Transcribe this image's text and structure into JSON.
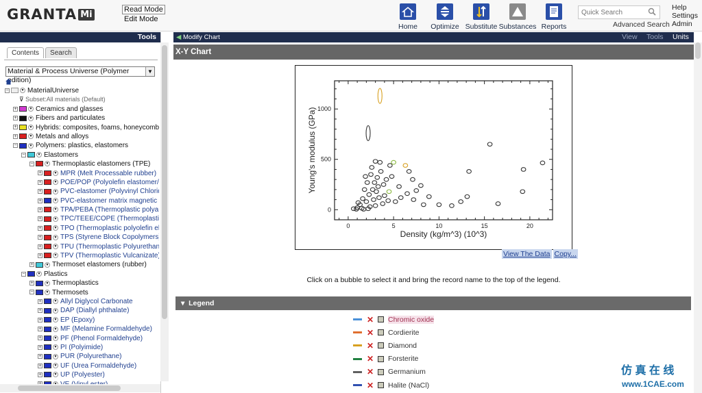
{
  "header": {
    "logo_text": "GRANTA",
    "logo_mi": "Mi",
    "read_mode": "Read Mode",
    "edit_mode": "Edit Mode",
    "nav": [
      {
        "label": "Home",
        "icon": "home-icon"
      },
      {
        "label": "Optimize",
        "icon": "optimize-icon"
      },
      {
        "label": "Substitute",
        "icon": "substitute-icon"
      },
      {
        "label": "Substances",
        "icon": "substances-icon"
      },
      {
        "label": "Reports",
        "icon": "reports-icon"
      }
    ],
    "search_placeholder": "Quick Search",
    "advanced_search": "Advanced Search",
    "help": "Help",
    "settings": "Settings",
    "admin": "Admin"
  },
  "sidebar": {
    "tools_label": "Tools",
    "tabs": [
      "Contents",
      "Search"
    ],
    "database": "Material & Process Universe (Polymer edition)",
    "tree": [
      {
        "label": "MaterialUniverse",
        "depth": 0
      },
      {
        "label": "Subset:All materials (Default)",
        "depth": 1
      },
      {
        "label": "Ceramics and glasses",
        "depth": 1,
        "color": "#d03ad0"
      },
      {
        "label": "Fibers and particulates",
        "depth": 1,
        "color": "#111111"
      },
      {
        "label": "Hybrids: composites, foams, honeycombs",
        "depth": 1,
        "color": "#e8e020"
      },
      {
        "label": "Metals and alloys",
        "depth": 1,
        "color": "#d82020"
      },
      {
        "label": "Polymers: plastics, elastomers",
        "depth": 1,
        "color": "#2030c0"
      },
      {
        "label": "Elastomers",
        "depth": 2,
        "color": "#40c8d8"
      },
      {
        "label": "Thermoplastic elastomers (TPE)",
        "depth": 3,
        "color": "#d82020"
      },
      {
        "label": "MPR (Melt Processable rubber)",
        "depth": 4,
        "color": "#d82020"
      },
      {
        "label": "POE/POP (Polyolefin elastomer/P",
        "depth": 4,
        "color": "#d82020"
      },
      {
        "label": "PVC-elastomer (Polyvinyl Chlorid",
        "depth": 4,
        "color": "#d82020"
      },
      {
        "label": "PVC-elastomer matrix magnetic r",
        "depth": 4,
        "color": "#2030c0"
      },
      {
        "label": "TPA/PEBA (Thermoplastic polyam",
        "depth": 4,
        "color": "#d82020"
      },
      {
        "label": "TPC/TEEE/COPE (Thermoplastic c",
        "depth": 4,
        "color": "#d82020"
      },
      {
        "label": "TPO (Thermoplastic polyolefin ela",
        "depth": 4,
        "color": "#d82020"
      },
      {
        "label": "TPS (Styrene Block Copolymers)",
        "depth": 4,
        "color": "#d82020"
      },
      {
        "label": "TPU (Thermoplastic Polyurethane",
        "depth": 4,
        "color": "#d82020"
      },
      {
        "label": "TPV (Thermoplastic Vulcanizate)",
        "depth": 4,
        "color": "#d82020"
      },
      {
        "label": "Thermoset elastomers (rubber)",
        "depth": 3,
        "color": "#40c8d8"
      },
      {
        "label": "Plastics",
        "depth": 2,
        "color": "#2030c0"
      },
      {
        "label": "Thermoplastics",
        "depth": 3,
        "color": "#2030c0"
      },
      {
        "label": "Thermosets",
        "depth": 3,
        "color": "#2030c0"
      },
      {
        "label": "Allyl Diglycol Carbonate",
        "depth": 4,
        "color": "#2030c0"
      },
      {
        "label": "DAP (Diallyl phthalate)",
        "depth": 4,
        "color": "#2030c0"
      },
      {
        "label": "EP (Epoxy)",
        "depth": 4,
        "color": "#2030c0"
      },
      {
        "label": "MF (Melamine Formaldehyde)",
        "depth": 4,
        "color": "#2030c0"
      },
      {
        "label": "PF (Phenol Formaldehyde)",
        "depth": 4,
        "color": "#2030c0"
      },
      {
        "label": "PI (Polyimide)",
        "depth": 4,
        "color": "#2030c0"
      },
      {
        "label": "PUR (Polyurethane)",
        "depth": 4,
        "color": "#2030c0"
      },
      {
        "label": "UF (Urea Formaldehyde)",
        "depth": 4,
        "color": "#2030c0"
      },
      {
        "label": "UP (Polyester)",
        "depth": 4,
        "color": "#2030c0"
      },
      {
        "label": "VE (Vinyl ester)",
        "depth": 4,
        "color": "#2030c0"
      }
    ]
  },
  "main": {
    "modify_chart": "Modify Chart",
    "view": "View",
    "tools": "Tools",
    "units": "Units",
    "chart_title": "X-Y Chart",
    "view_data": "View The Data",
    "copy": "Copy...",
    "instructions": "Click on a bubble to select it and bring the record name to the top of the legend.",
    "legend_title": "Legend",
    "legend": [
      {
        "name": "Chromic oxide",
        "color": "#4a90d9",
        "selected": true
      },
      {
        "name": "Cordierite",
        "color": "#e07030",
        "selected": false
      },
      {
        "name": "Diamond",
        "color": "#d8a020",
        "selected": false
      },
      {
        "name": "Forsterite",
        "color": "#208040",
        "selected": false
      },
      {
        "name": "Germanium",
        "color": "#606060",
        "selected": false
      },
      {
        "name": "Halite (NaCl)",
        "color": "#3050b0",
        "selected": false
      }
    ]
  },
  "chart_data": {
    "type": "scatter",
    "xlabel": "Density (kg/m^3) (10^3)",
    "ylabel": "Young's modulus (GPa)",
    "xlim": [
      -1.5,
      22.5
    ],
    "ylim": [
      -100,
      1280
    ],
    "xticks": [
      0,
      5,
      10,
      15,
      20
    ],
    "yticks": [
      0,
      500,
      1000
    ],
    "points": [
      {
        "x": 3.5,
        "y": 1130,
        "color": "#d8a020"
      },
      {
        "x": 2.2,
        "y": 760,
        "color": "#333333"
      },
      {
        "x": 15.6,
        "y": 650,
        "color": "#333333"
      },
      {
        "x": 21.4,
        "y": 465,
        "color": "#333333"
      },
      {
        "x": 19.3,
        "y": 400,
        "color": "#333333"
      },
      {
        "x": 13.3,
        "y": 380,
        "color": "#333333"
      },
      {
        "x": 6.3,
        "y": 440,
        "color": "#d8a020"
      },
      {
        "x": 6.7,
        "y": 380,
        "color": "#333333"
      },
      {
        "x": 4.6,
        "y": 440,
        "color": "#333333"
      },
      {
        "x": 5.0,
        "y": 470,
        "color": "#8ab840"
      },
      {
        "x": 7.1,
        "y": 300,
        "color": "#333333"
      },
      {
        "x": 8.0,
        "y": 240,
        "color": "#333333"
      },
      {
        "x": 7.5,
        "y": 190,
        "color": "#333333"
      },
      {
        "x": 8.9,
        "y": 130,
        "color": "#333333"
      },
      {
        "x": 10.0,
        "y": 50,
        "color": "#333333"
      },
      {
        "x": 11.4,
        "y": 40,
        "color": "#333333"
      },
      {
        "x": 12.4,
        "y": 80,
        "color": "#333333"
      },
      {
        "x": 13.1,
        "y": 130,
        "color": "#333333"
      },
      {
        "x": 19.2,
        "y": 180,
        "color": "#333333"
      },
      {
        "x": 16.5,
        "y": 60,
        "color": "#333333"
      },
      {
        "x": 8.3,
        "y": 50,
        "color": "#333333"
      },
      {
        "x": 7.2,
        "y": 100,
        "color": "#333333"
      },
      {
        "x": 6.5,
        "y": 160,
        "color": "#333333"
      },
      {
        "x": 5.6,
        "y": 230,
        "color": "#333333"
      },
      {
        "x": 5.8,
        "y": 120,
        "color": "#333333"
      },
      {
        "x": 4.5,
        "y": 180,
        "color": "#8ab840"
      },
      {
        "x": 3.9,
        "y": 250,
        "color": "#333333"
      },
      {
        "x": 3.2,
        "y": 320,
        "color": "#333333"
      },
      {
        "x": 3.6,
        "y": 380,
        "color": "#333333"
      },
      {
        "x": 2.6,
        "y": 420,
        "color": "#333333"
      },
      {
        "x": 3.0,
        "y": 480,
        "color": "#333333"
      },
      {
        "x": 3.5,
        "y": 470,
        "color": "#333333"
      },
      {
        "x": 2.5,
        "y": 350,
        "color": "#333333"
      },
      {
        "x": 2.1,
        "y": 270,
        "color": "#333333"
      },
      {
        "x": 1.8,
        "y": 200,
        "color": "#333333"
      },
      {
        "x": 2.7,
        "y": 200,
        "color": "#333333"
      },
      {
        "x": 3.1,
        "y": 180,
        "color": "#333333"
      },
      {
        "x": 2.3,
        "y": 150,
        "color": "#333333"
      },
      {
        "x": 3.4,
        "y": 120,
        "color": "#333333"
      },
      {
        "x": 2.8,
        "y": 100,
        "color": "#333333"
      },
      {
        "x": 1.6,
        "y": 110,
        "color": "#333333"
      },
      {
        "x": 2.0,
        "y": 80,
        "color": "#333333"
      },
      {
        "x": 1.3,
        "y": 50,
        "color": "#333333"
      },
      {
        "x": 1.0,
        "y": 20,
        "color": "#333333"
      },
      {
        "x": 0.6,
        "y": 10,
        "color": "#333333"
      },
      {
        "x": 1.5,
        "y": 15,
        "color": "#333333"
      },
      {
        "x": 2.4,
        "y": 30,
        "color": "#333333"
      },
      {
        "x": 3.0,
        "y": 40,
        "color": "#333333"
      },
      {
        "x": 3.8,
        "y": 60,
        "color": "#333333"
      },
      {
        "x": 4.4,
        "y": 90,
        "color": "#333333"
      },
      {
        "x": 4.0,
        "y": 140,
        "color": "#333333"
      },
      {
        "x": 3.3,
        "y": 230,
        "color": "#333333"
      },
      {
        "x": 2.9,
        "y": 270,
        "color": "#333333"
      },
      {
        "x": 4.2,
        "y": 300,
        "color": "#333333"
      },
      {
        "x": 1.9,
        "y": 330,
        "color": "#333333"
      },
      {
        "x": 1.1,
        "y": 70,
        "color": "#333333"
      },
      {
        "x": 0.9,
        "y": 5,
        "color": "#333333"
      },
      {
        "x": 1.7,
        "y": 5,
        "color": "#333333"
      },
      {
        "x": 2.2,
        "y": 10,
        "color": "#333333"
      },
      {
        "x": 5.2,
        "y": 80,
        "color": "#333333"
      },
      {
        "x": 4.8,
        "y": 330,
        "color": "#333333"
      }
    ]
  }
}
